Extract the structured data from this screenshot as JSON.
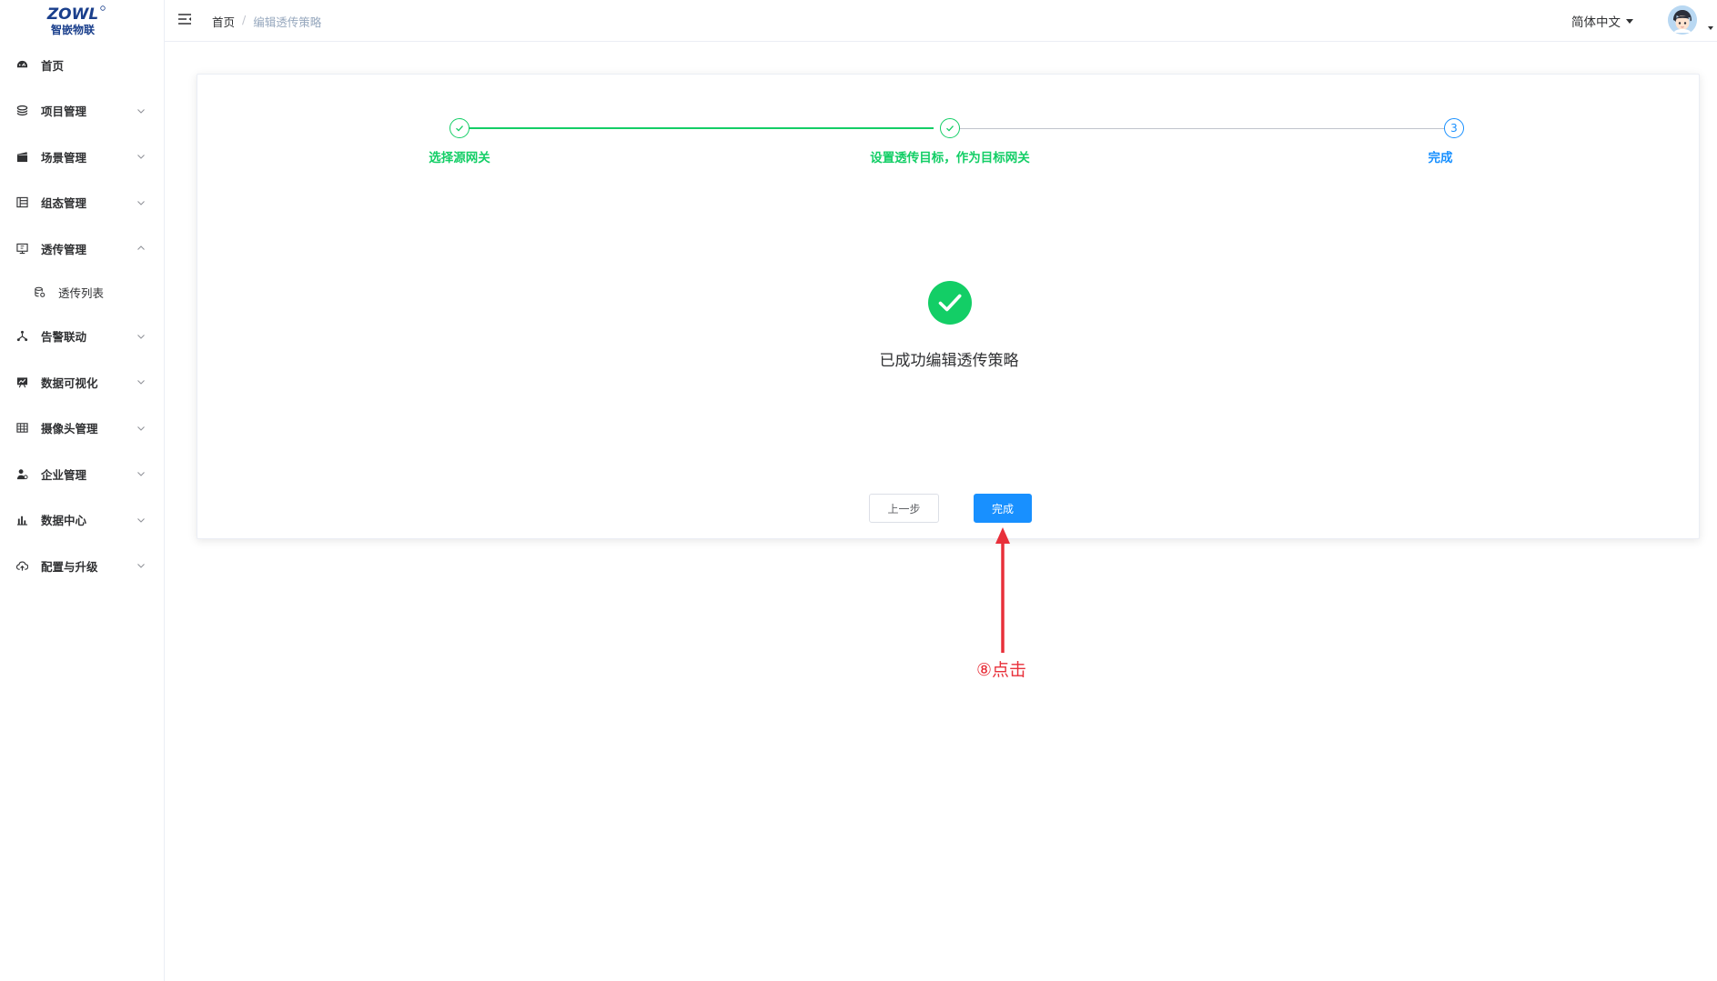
{
  "app": {
    "logo_text_top": "ZOWL",
    "logo_text_bottom": "智嵌物联",
    "brand_color": "#1a3f8c"
  },
  "sidebar": {
    "items": [
      {
        "label": "首页",
        "icon": "dashboard-icon",
        "has_arrow": false
      },
      {
        "label": "项目管理",
        "icon": "layers-icon",
        "has_arrow": true
      },
      {
        "label": "场景管理",
        "icon": "clapperboard-icon",
        "has_arrow": true
      },
      {
        "label": "组态管理",
        "icon": "tree-table-icon",
        "has_arrow": true
      },
      {
        "label": "透传管理",
        "icon": "monitor-icon",
        "has_arrow": true,
        "expanded": true
      },
      {
        "label": "透传列表",
        "icon": "database-icon",
        "has_arrow": false,
        "sub": true
      },
      {
        "label": "告警联动",
        "icon": "network-icon",
        "has_arrow": true
      },
      {
        "label": "数据可视化",
        "icon": "chart-screen-icon",
        "has_arrow": true
      },
      {
        "label": "摄像头管理",
        "icon": "grid-table-icon",
        "has_arrow": true
      },
      {
        "label": "企业管理",
        "icon": "user-settings-icon",
        "has_arrow": true
      },
      {
        "label": "数据中心",
        "icon": "bar-chart-icon",
        "has_arrow": true
      },
      {
        "label": "配置与升级",
        "icon": "cloud-upload-icon",
        "has_arrow": true
      }
    ]
  },
  "header": {
    "breadcrumb_home": "首页",
    "breadcrumb_sep": "/",
    "breadcrumb_current": "编辑透传策略",
    "language": "简体中文"
  },
  "steps": {
    "items": [
      {
        "title": "选择源网关",
        "status": "finish"
      },
      {
        "title": "设置透传目标，作为目标网关",
        "status": "finish"
      },
      {
        "title": "完成",
        "status": "process",
        "number": "3"
      }
    ],
    "finish_color": "#13ce66",
    "process_color": "#1890ff"
  },
  "result": {
    "title": "已成功编辑透传策略",
    "icon": "success-check-icon",
    "icon_color": "#13ce66"
  },
  "buttons": {
    "prev_label": "上一步",
    "done_label": "完成",
    "primary_color": "#1890ff"
  },
  "annotation": {
    "text": "⑧点击",
    "color": "#e8303a"
  }
}
